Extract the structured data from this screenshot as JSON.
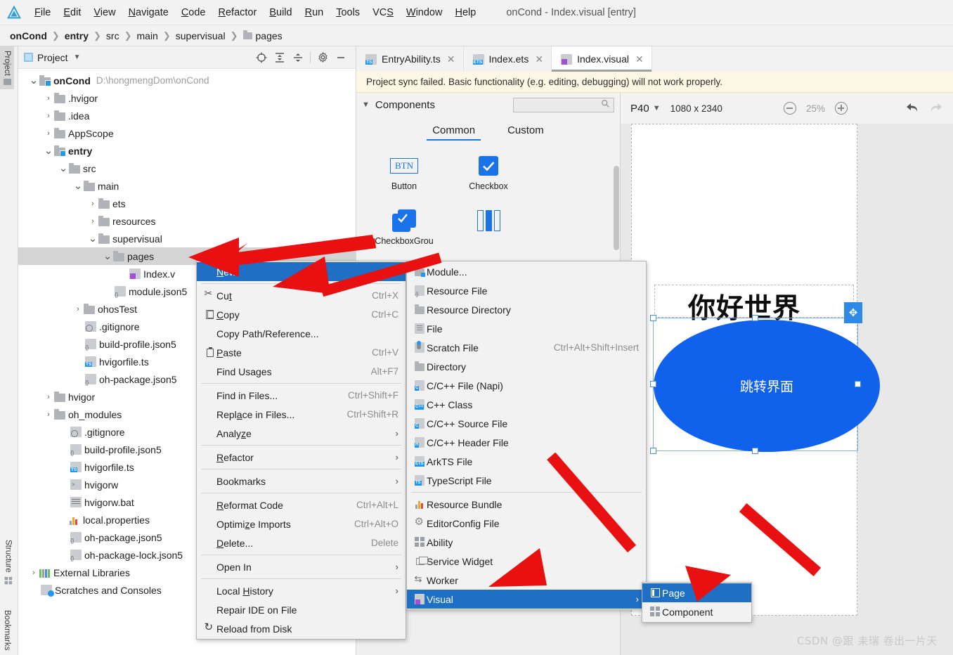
{
  "window": {
    "title": "onCond - Index.visual [entry]"
  },
  "menubar": {
    "items": [
      "File",
      "Edit",
      "View",
      "Navigate",
      "Code",
      "Refactor",
      "Build",
      "Run",
      "Tools",
      "VCS",
      "Window",
      "Help"
    ]
  },
  "breadcrumb": {
    "items": [
      "onCond",
      "entry",
      "src",
      "main",
      "supervisual",
      "pages"
    ]
  },
  "left_strip": {
    "project": "Project",
    "structure": "Structure",
    "bookmarks": "Bookmarks"
  },
  "project_panel": {
    "title": "Project",
    "tree": [
      {
        "depth": 0,
        "twisty": "⌄",
        "icon": "module-folder",
        "label": "onCond",
        "bold": true,
        "path": "D:\\hongmengDom\\onCond"
      },
      {
        "depth": 1,
        "twisty": "›",
        "icon": "folder",
        "label": ".hvigor"
      },
      {
        "depth": 1,
        "twisty": "›",
        "icon": "folder",
        "label": ".idea"
      },
      {
        "depth": 1,
        "twisty": "›",
        "icon": "folder",
        "label": "AppScope"
      },
      {
        "depth": 1,
        "twisty": "⌄",
        "icon": "module-folder",
        "label": "entry",
        "bold": true
      },
      {
        "depth": 2,
        "twisty": "⌄",
        "icon": "folder",
        "label": "src"
      },
      {
        "depth": 3,
        "twisty": "⌄",
        "icon": "folder",
        "label": "main"
      },
      {
        "depth": 4,
        "twisty": "›",
        "icon": "folder",
        "label": "ets"
      },
      {
        "depth": 4,
        "twisty": "›",
        "icon": "folder",
        "label": "resources"
      },
      {
        "depth": 4,
        "twisty": "⌄",
        "icon": "folder",
        "label": "supervisual"
      },
      {
        "depth": 5,
        "twisty": "⌄",
        "icon": "folder",
        "label": "pages",
        "selected": true
      },
      {
        "depth": 6,
        "twisty": "",
        "icon": "visual-file",
        "label": "Index.v"
      },
      {
        "depth": 5,
        "twisty": "",
        "icon": "json-file",
        "label": "module.json5"
      },
      {
        "depth": 3,
        "twisty": "›",
        "icon": "folder",
        "label": "ohosTest"
      },
      {
        "depth": 3,
        "twisty": "",
        "icon": "gitignore-file",
        "label": ".gitignore"
      },
      {
        "depth": 3,
        "twisty": "",
        "icon": "json-file",
        "label": "build-profile.json5"
      },
      {
        "depth": 3,
        "twisty": "",
        "icon": "ts-file",
        "label": "hvigorfile.ts"
      },
      {
        "depth": 3,
        "twisty": "",
        "icon": "json-file",
        "label": "oh-package.json5"
      },
      {
        "depth": 1,
        "twisty": "›",
        "icon": "folder",
        "label": "hvigor"
      },
      {
        "depth": 1,
        "twisty": "›",
        "icon": "folder",
        "label": "oh_modules"
      },
      {
        "depth": 2,
        "twisty": "",
        "icon": "gitignore-file",
        "label": ".gitignore"
      },
      {
        "depth": 2,
        "twisty": "",
        "icon": "json-file",
        "label": "build-profile.json5"
      },
      {
        "depth": 2,
        "twisty": "",
        "icon": "ts-file",
        "label": "hvigorfile.ts"
      },
      {
        "depth": 2,
        "twisty": "",
        "icon": "script-file",
        "label": "hvigorw"
      },
      {
        "depth": 2,
        "twisty": "",
        "icon": "bat-file",
        "label": "hvigorw.bat"
      },
      {
        "depth": 2,
        "twisty": "",
        "icon": "properties-file",
        "label": "local.properties"
      },
      {
        "depth": 2,
        "twisty": "",
        "icon": "json-file",
        "label": "oh-package.json5"
      },
      {
        "depth": 2,
        "twisty": "",
        "icon": "json-file",
        "label": "oh-package-lock.json5"
      },
      {
        "depth": 0,
        "twisty": "›",
        "icon": "libraries",
        "label": "External Libraries"
      },
      {
        "depth": 0,
        "twisty": "",
        "icon": "scratches",
        "label": "Scratches and Consoles"
      }
    ]
  },
  "editor": {
    "tabs": [
      {
        "label": "EntryAbility.ts",
        "icon": "ts-file",
        "active": false
      },
      {
        "label": "Index.ets",
        "icon": "ets-file",
        "active": false
      },
      {
        "label": "Index.visual",
        "icon": "visual-file",
        "active": true
      }
    ],
    "sync_banner": "Project sync failed. Basic functionality (e.g. editing, debugging) will not work properly."
  },
  "components": {
    "title": "Components",
    "search_placeholder": "",
    "search_value": "",
    "tabs": [
      {
        "label": "Common",
        "active": true
      },
      {
        "label": "Custom",
        "active": false
      }
    ],
    "items": [
      {
        "label": "Button",
        "icon": "button-icon"
      },
      {
        "label": "Checkbox",
        "icon": "checkbox-icon"
      },
      {
        "label": "CheckboxGrou",
        "icon": "checkbox-group-icon"
      },
      {
        "label": "",
        "icon": "columnsplit-icon"
      },
      {
        "label": "",
        "icon": "datepicker-icon"
      },
      {
        "label": "",
        "icon": "divider-icon"
      }
    ]
  },
  "preview": {
    "device": "P40",
    "resolution": "1080 x 2340",
    "zoom": "25%",
    "title_text": "你好世界",
    "button_text": "跳转界面",
    "accent": "#1062ec"
  },
  "context_menu": [
    {
      "label": "New",
      "icon": "",
      "key": "",
      "arrow": "›",
      "highlight": true,
      "underline": "N"
    },
    {
      "sep": true
    },
    {
      "label": "Cut",
      "icon": "scissors-icon",
      "key": "Ctrl+X"
    },
    {
      "label": "Copy",
      "icon": "copy-icon",
      "key": "Ctrl+C"
    },
    {
      "label": "Copy Path/Reference...",
      "icon": "",
      "key": ""
    },
    {
      "label": "Paste",
      "icon": "paste-icon",
      "key": "Ctrl+V"
    },
    {
      "label": "Find Usages",
      "icon": "",
      "key": "Alt+F7"
    },
    {
      "sep": true
    },
    {
      "label": "Find in Files...",
      "icon": "",
      "key": "Ctrl+Shift+F"
    },
    {
      "label": "Replace in Files...",
      "icon": "",
      "key": "Ctrl+Shift+R"
    },
    {
      "label": "Analyze",
      "icon": "",
      "key": "",
      "arrow": "›"
    },
    {
      "sep": true
    },
    {
      "label": "Refactor",
      "icon": "",
      "key": "",
      "arrow": "›"
    },
    {
      "sep": true
    },
    {
      "label": "Bookmarks",
      "icon": "",
      "key": "",
      "arrow": "›"
    },
    {
      "sep": true
    },
    {
      "label": "Reformat Code",
      "icon": "",
      "key": "Ctrl+Alt+L"
    },
    {
      "label": "Optimize Imports",
      "icon": "",
      "key": "Ctrl+Alt+O"
    },
    {
      "label": "Delete...",
      "icon": "",
      "key": "Delete"
    },
    {
      "sep": true
    },
    {
      "label": "Open In",
      "icon": "",
      "key": "",
      "arrow": "›"
    },
    {
      "sep": true
    },
    {
      "label": "Local History",
      "icon": "",
      "key": "",
      "arrow": "›"
    },
    {
      "label": "Repair IDE on File",
      "icon": "",
      "key": ""
    },
    {
      "label": "Reload from Disk",
      "icon": "reload-icon",
      "key": ""
    }
  ],
  "new_menu": [
    {
      "label": "Module...",
      "icon": "module-folder-icon"
    },
    {
      "label": "Resource File",
      "icon": "json-file-icon"
    },
    {
      "label": "Resource Directory",
      "icon": "folder-icon"
    },
    {
      "label": "File",
      "icon": "file-icon"
    },
    {
      "label": "Scratch File",
      "icon": "scratch-file-icon",
      "key": "Ctrl+Alt+Shift+Insert"
    },
    {
      "label": "Directory",
      "icon": "folder-icon"
    },
    {
      "label": "C/C++ File (Napi)",
      "icon": "c-file-icon"
    },
    {
      "label": "C++ Class",
      "icon": "cpp-file-icon"
    },
    {
      "label": "C/C++ Source File",
      "icon": "c-source-icon"
    },
    {
      "label": "C/C++ Header File",
      "icon": "h-file-icon"
    },
    {
      "label": "ArkTS File",
      "icon": "ets-file-icon"
    },
    {
      "label": "TypeScript File",
      "icon": "ts-file-icon"
    },
    {
      "sep": true
    },
    {
      "label": "Resource Bundle",
      "icon": "bundle-icon"
    },
    {
      "label": "EditorConfig File",
      "icon": "gear-icon"
    },
    {
      "label": "Ability",
      "icon": "ability-icon"
    },
    {
      "label": "Service Widget",
      "icon": "widget-icon"
    },
    {
      "label": "Worker",
      "icon": "worker-icon"
    },
    {
      "label": "Visual",
      "icon": "visual-file-icon",
      "arrow": "›",
      "highlight": true
    }
  ],
  "visual_menu": [
    {
      "label": "Page",
      "icon": "page-icon",
      "highlight": true
    },
    {
      "label": "Component",
      "icon": "component-icon"
    }
  ],
  "watermark": "CSDN @跟 耒瑞 卷出一片天"
}
